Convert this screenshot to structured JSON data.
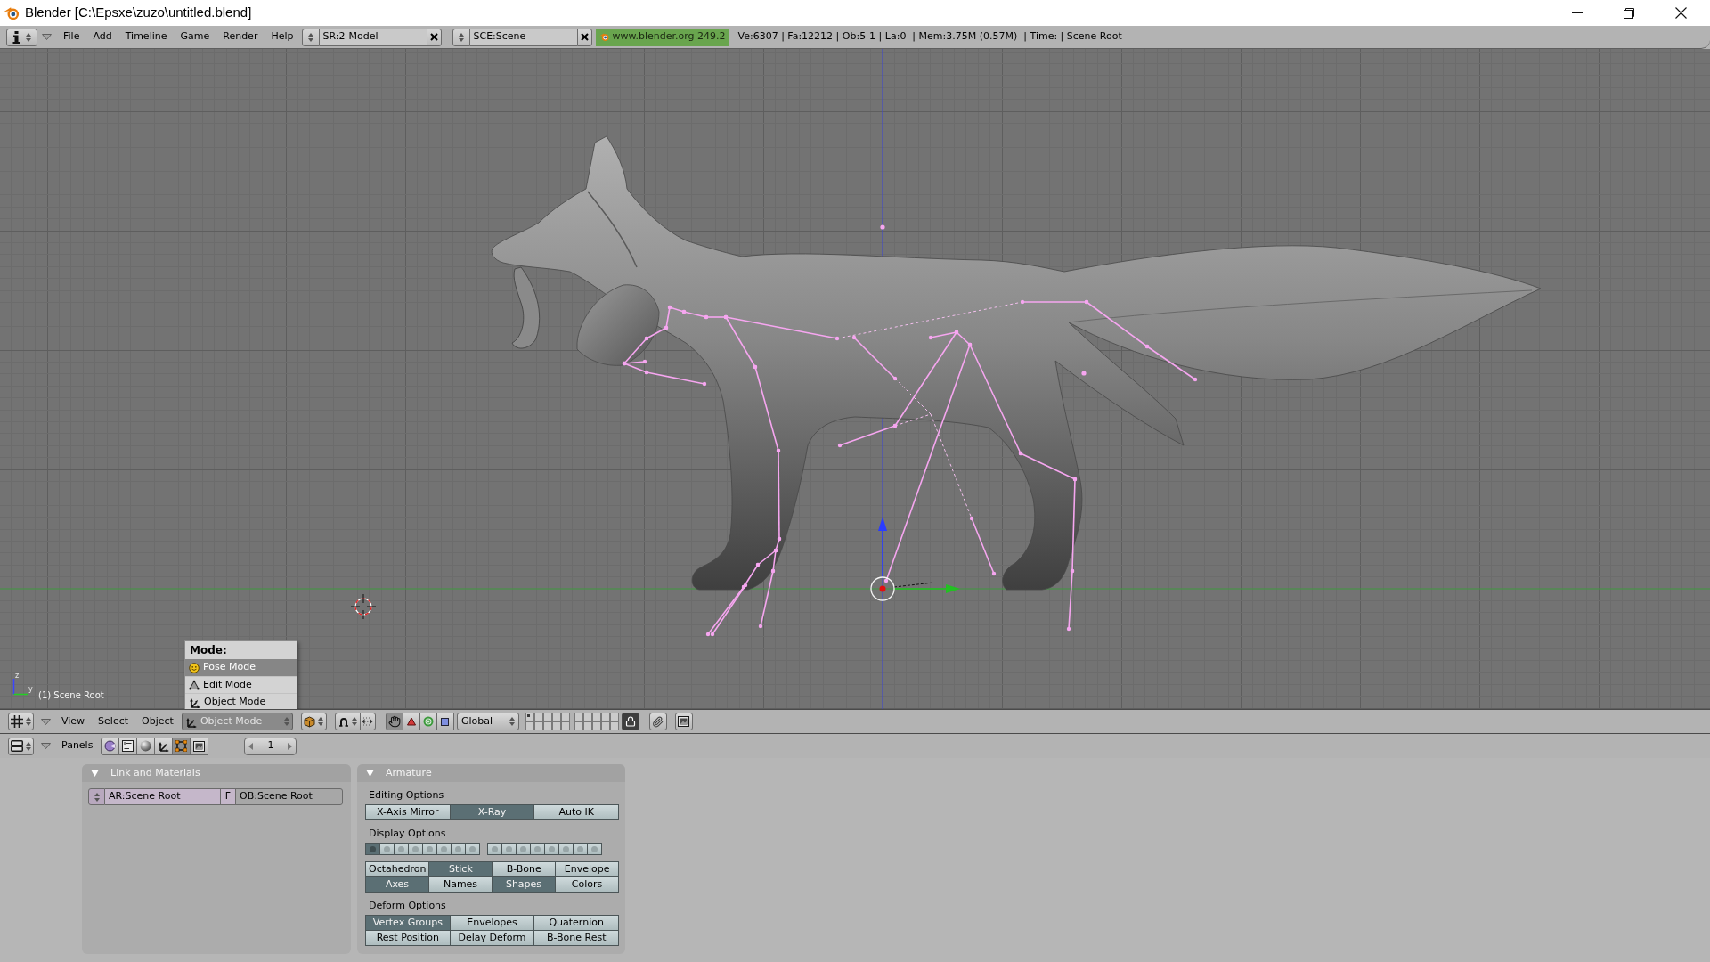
{
  "window": {
    "title": "Blender [C:\\Epsxe\\zuzo\\untitled.blend]"
  },
  "info_header": {
    "menus": [
      "File",
      "Add",
      "Timeline",
      "Game",
      "Render",
      "Help"
    ],
    "screen": "SR:2-Model",
    "scene": "SCE:Scene",
    "version": "www.blender.org 249.2",
    "stats": "Ve:6307 | Fa:12212 | Ob:5-1 | La:0  | Mem:3.75M (0.57M)  | Time: | Scene Root"
  },
  "viewport": {
    "axis_labels": [
      "z",
      "y"
    ],
    "object_label": "(1) Scene Root"
  },
  "mode_menu": {
    "open": true,
    "title": "Mode:",
    "items": [
      {
        "kind": "pose",
        "label": "Pose Mode",
        "selected": true
      },
      {
        "kind": "edit",
        "label": "Edit Mode",
        "selected": false
      },
      {
        "kind": "object",
        "label": "Object Mode",
        "selected": false
      }
    ]
  },
  "view_header": {
    "menus": [
      "View",
      "Select",
      "Object"
    ],
    "mode": "Object Mode",
    "manipulators": [
      {
        "kind": "hand",
        "selected": true
      },
      {
        "kind": "translate",
        "selected": false
      },
      {
        "kind": "rotate",
        "selected": false
      },
      {
        "kind": "scale",
        "selected": false
      }
    ],
    "orientation": "Global",
    "layers": [
      {
        "used": true
      },
      {
        "used": false
      },
      {
        "used": false
      },
      {
        "used": false
      },
      {
        "used": false
      },
      {
        "used": false
      },
      {
        "used": false
      },
      {
        "used": false
      },
      {
        "used": false
      },
      {
        "used": false
      },
      {
        "used": false
      },
      {
        "used": false
      },
      {
        "used": false
      },
      {
        "used": false
      },
      {
        "used": false
      },
      {
        "used": false
      },
      {
        "used": false
      },
      {
        "used": false
      },
      {
        "used": false
      },
      {
        "used": false
      }
    ],
    "locked": true
  },
  "buttons_header": {
    "label": "Panels",
    "contexts": [
      {
        "kind": "logic",
        "selected": false
      },
      {
        "kind": "script",
        "selected": false
      },
      {
        "kind": "shading",
        "selected": false
      },
      {
        "kind": "object",
        "selected": false
      },
      {
        "kind": "editing",
        "selected": true
      },
      {
        "kind": "scene",
        "selected": false
      }
    ],
    "frame": "1"
  },
  "link_panel": {
    "title": "Link and Materials",
    "armature": "AR:Scene Root",
    "fake_user": "F",
    "object": "OB:Scene Root"
  },
  "armature_panel": {
    "title": "Armature",
    "sections": [
      {
        "title": "Editing Options",
        "rows": [
          [
            {
              "label": "X-Axis Mirror",
              "on": false
            },
            {
              "label": "X-Ray",
              "on": true
            },
            {
              "label": "Auto IK",
              "on": false
            }
          ]
        ]
      },
      {
        "title": "Display Options",
        "layers": [
          {
            "on": true
          },
          {
            "on": false
          },
          {
            "on": false
          },
          {
            "on": false
          },
          {
            "on": false
          },
          {
            "on": false
          },
          {
            "on": false
          },
          {
            "on": false
          },
          {
            "on": false
          },
          {
            "on": false
          },
          {
            "on": false
          },
          {
            "on": false
          },
          {
            "on": false
          },
          {
            "on": false
          },
          {
            "on": false
          },
          {
            "on": false
          }
        ],
        "rows": [
          [
            {
              "label": "Octahedron",
              "on": false
            },
            {
              "label": "Stick",
              "on": true
            },
            {
              "label": "B-Bone",
              "on": false
            },
            {
              "label": "Envelope",
              "on": false
            }
          ],
          [
            {
              "label": "Axes",
              "on": true
            },
            {
              "label": "Names",
              "on": false
            },
            {
              "label": "Shapes",
              "on": true
            },
            {
              "label": "Colors",
              "on": false
            }
          ]
        ]
      },
      {
        "title": "Deform Options",
        "rows": [
          [
            {
              "label": "Vertex Groups",
              "on": true
            },
            {
              "label": "Envelopes",
              "on": false
            },
            {
              "label": "Quaternion",
              "on": false
            }
          ],
          [
            {
              "label": "Rest Position",
              "on": false
            },
            {
              "label": "Delay Deform",
              "on": false
            },
            {
              "label": "B-Bone Rest",
              "on": false
            }
          ]
        ]
      }
    ]
  }
}
